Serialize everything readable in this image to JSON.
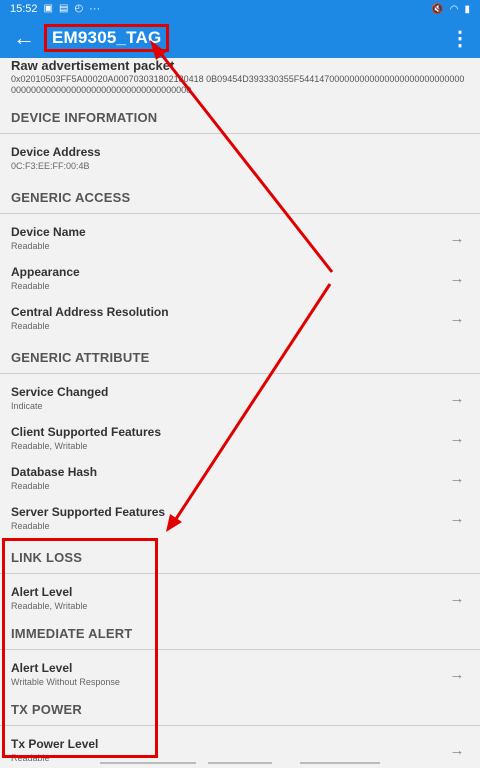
{
  "status_bar": {
    "time": "15:52",
    "overflow": "···"
  },
  "app_bar": {
    "title": "EM9305_TAG",
    "back_icon": "arrow-left-icon",
    "menu_icon": "more-vert-icon"
  },
  "raw": {
    "title": "Raw advertisement packet",
    "value": "0x02010503FF5A00020A000703031802180418 0B09454D393330355F544147000000000000000000000000000000000000000000000000000000000000000"
  },
  "device_information": {
    "header": "DEVICE INFORMATION",
    "items": [
      {
        "title": "Device Address",
        "subtitle": "0C:F3:EE:FF:00:4B"
      }
    ]
  },
  "generic_access": {
    "header": "GENERIC ACCESS",
    "items": [
      {
        "title": "Device Name",
        "subtitle": "Readable"
      },
      {
        "title": "Appearance",
        "subtitle": "Readable"
      },
      {
        "title": "Central Address Resolution",
        "subtitle": "Readable"
      }
    ]
  },
  "generic_attribute": {
    "header": "GENERIC ATTRIBUTE",
    "items": [
      {
        "title": "Service Changed",
        "subtitle": "Indicate"
      },
      {
        "title": "Client Supported Features",
        "subtitle": "Readable, Writable"
      },
      {
        "title": "Database Hash",
        "subtitle": "Readable"
      },
      {
        "title": "Server Supported Features",
        "subtitle": "Readable"
      }
    ]
  },
  "link_loss": {
    "header": "LINK LOSS",
    "items": [
      {
        "title": "Alert Level",
        "subtitle": "Readable, Writable"
      }
    ]
  },
  "immediate_alert": {
    "header": "IMMEDIATE ALERT",
    "items": [
      {
        "title": "Alert Level",
        "subtitle": "Writable Without Response"
      }
    ]
  },
  "tx_power": {
    "header": "TX POWER",
    "items": [
      {
        "title": "Tx Power Level",
        "subtitle": "Readable"
      }
    ]
  },
  "colors": {
    "app_bar": "#1e88e5",
    "annotation": "#e00000"
  }
}
